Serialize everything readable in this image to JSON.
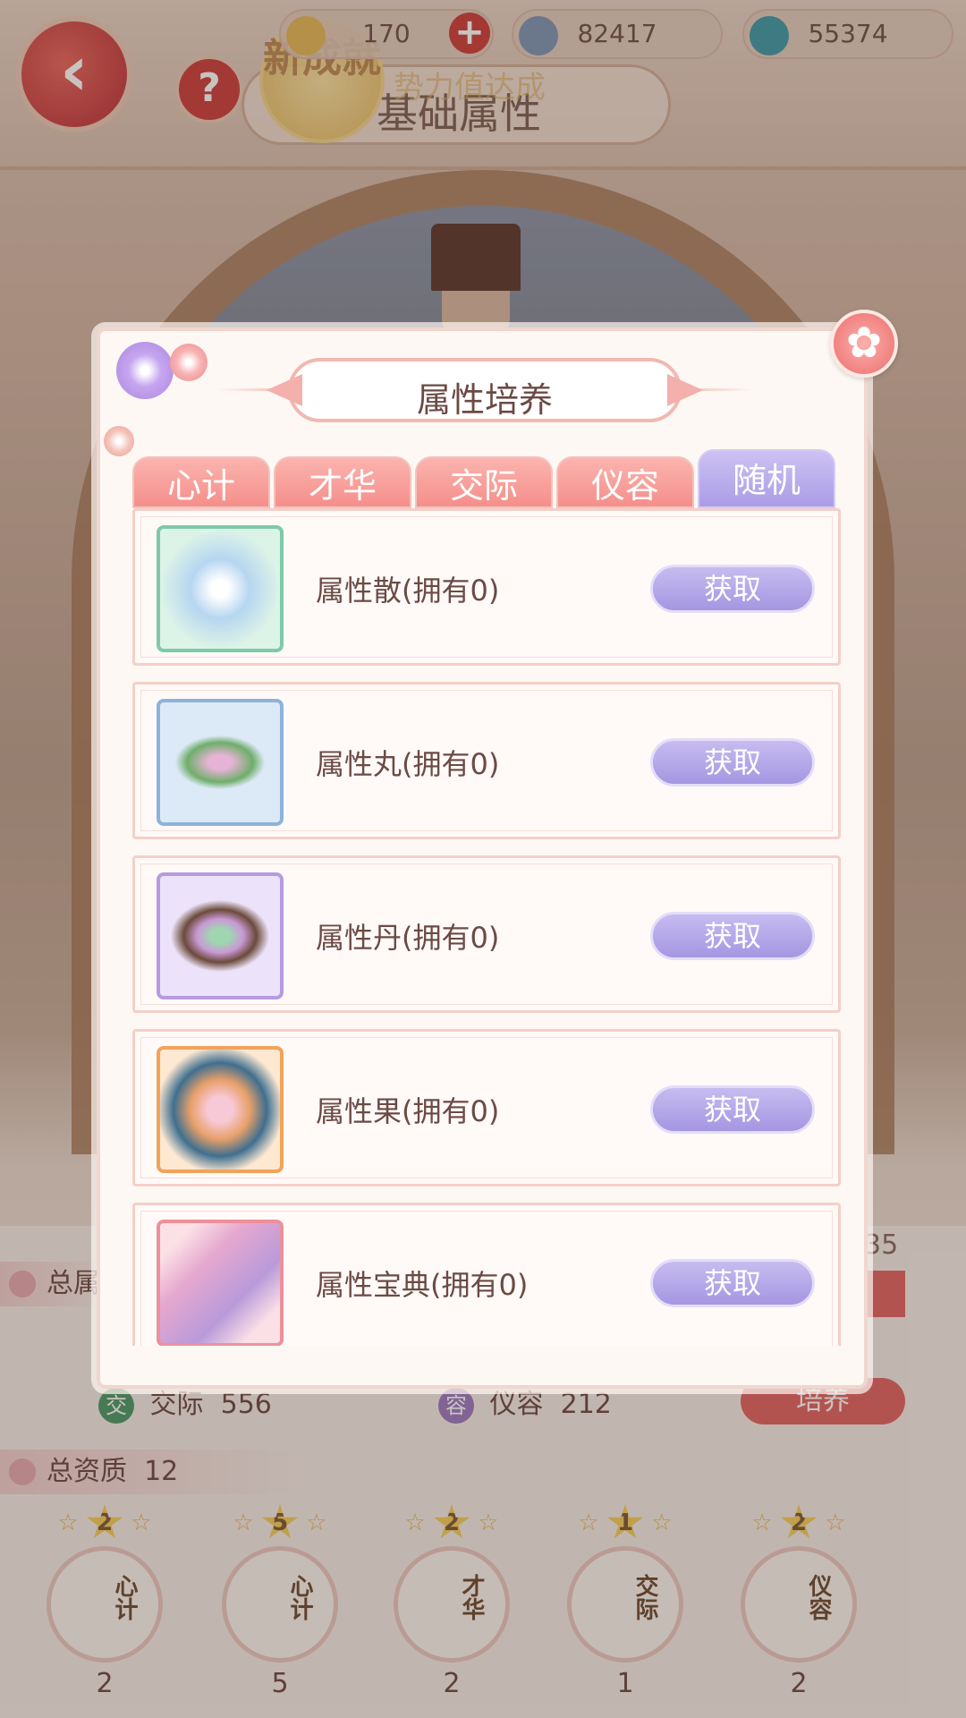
{
  "header": {
    "back_glyph": "‹",
    "help_glyph": "?",
    "achievement_label": "新成就",
    "currencies": [
      {
        "name": "ingot",
        "value": "170",
        "color": "#e3b95a"
      },
      {
        "name": "silver",
        "value": "82417",
        "color": "#7d98b8"
      },
      {
        "name": "jade",
        "value": "55374",
        "color": "#3f9aa8"
      }
    ],
    "plus_glyph": "+",
    "title": "基础属性",
    "notice": "势力值达成"
  },
  "background": {
    "side_value": "35",
    "stats": [
      {
        "badge": "交",
        "label": "交际",
        "value": "556",
        "color": "#4c9a6a"
      },
      {
        "badge": "容",
        "label": "仪容",
        "value": "212",
        "color": "#9b7bc2"
      }
    ],
    "train_label": "培养",
    "total_label": "总属",
    "aptitude_label": "总资质",
    "aptitude_value": "12",
    "talents": [
      {
        "rank": "2",
        "char": "心计",
        "count": "2"
      },
      {
        "rank": "5",
        "char": "心计",
        "count": "5"
      },
      {
        "rank": "2",
        "char": "才华",
        "count": "2"
      },
      {
        "rank": "1",
        "char": "交际",
        "count": "1"
      },
      {
        "rank": "2",
        "char": "仪容",
        "count": "2"
      }
    ]
  },
  "modal": {
    "title": "属性培养",
    "close_glyph": "✿",
    "tabs": [
      {
        "label": "心计",
        "active": false
      },
      {
        "label": "才华",
        "active": false
      },
      {
        "label": "交际",
        "active": false
      },
      {
        "label": "仪容",
        "active": false
      },
      {
        "label": "随机",
        "active": true
      }
    ],
    "items": [
      {
        "name": "属性散(拥有0)",
        "button": "获取",
        "icon": "powder-box-icon",
        "frame": "#7ec9a9",
        "bg": "#dcf3e8"
      },
      {
        "name": "属性丸(拥有0)",
        "button": "获取",
        "icon": "pill-leaf-icon",
        "frame": "#8eb2d9",
        "bg": "#dce9f7"
      },
      {
        "name": "属性丹(拥有0)",
        "button": "获取",
        "icon": "elixir-tray-icon",
        "frame": "#b79ae0",
        "bg": "#ece3fa"
      },
      {
        "name": "属性果(拥有0)",
        "button": "获取",
        "icon": "peach-plate-icon",
        "frame": "#f2a35a",
        "bg": "#fde8d2"
      },
      {
        "name": "属性宝典(拥有0)",
        "button": "获取",
        "icon": "book-icon",
        "frame": "#ee8f9c",
        "bg": "#fbe0e6"
      }
    ]
  }
}
